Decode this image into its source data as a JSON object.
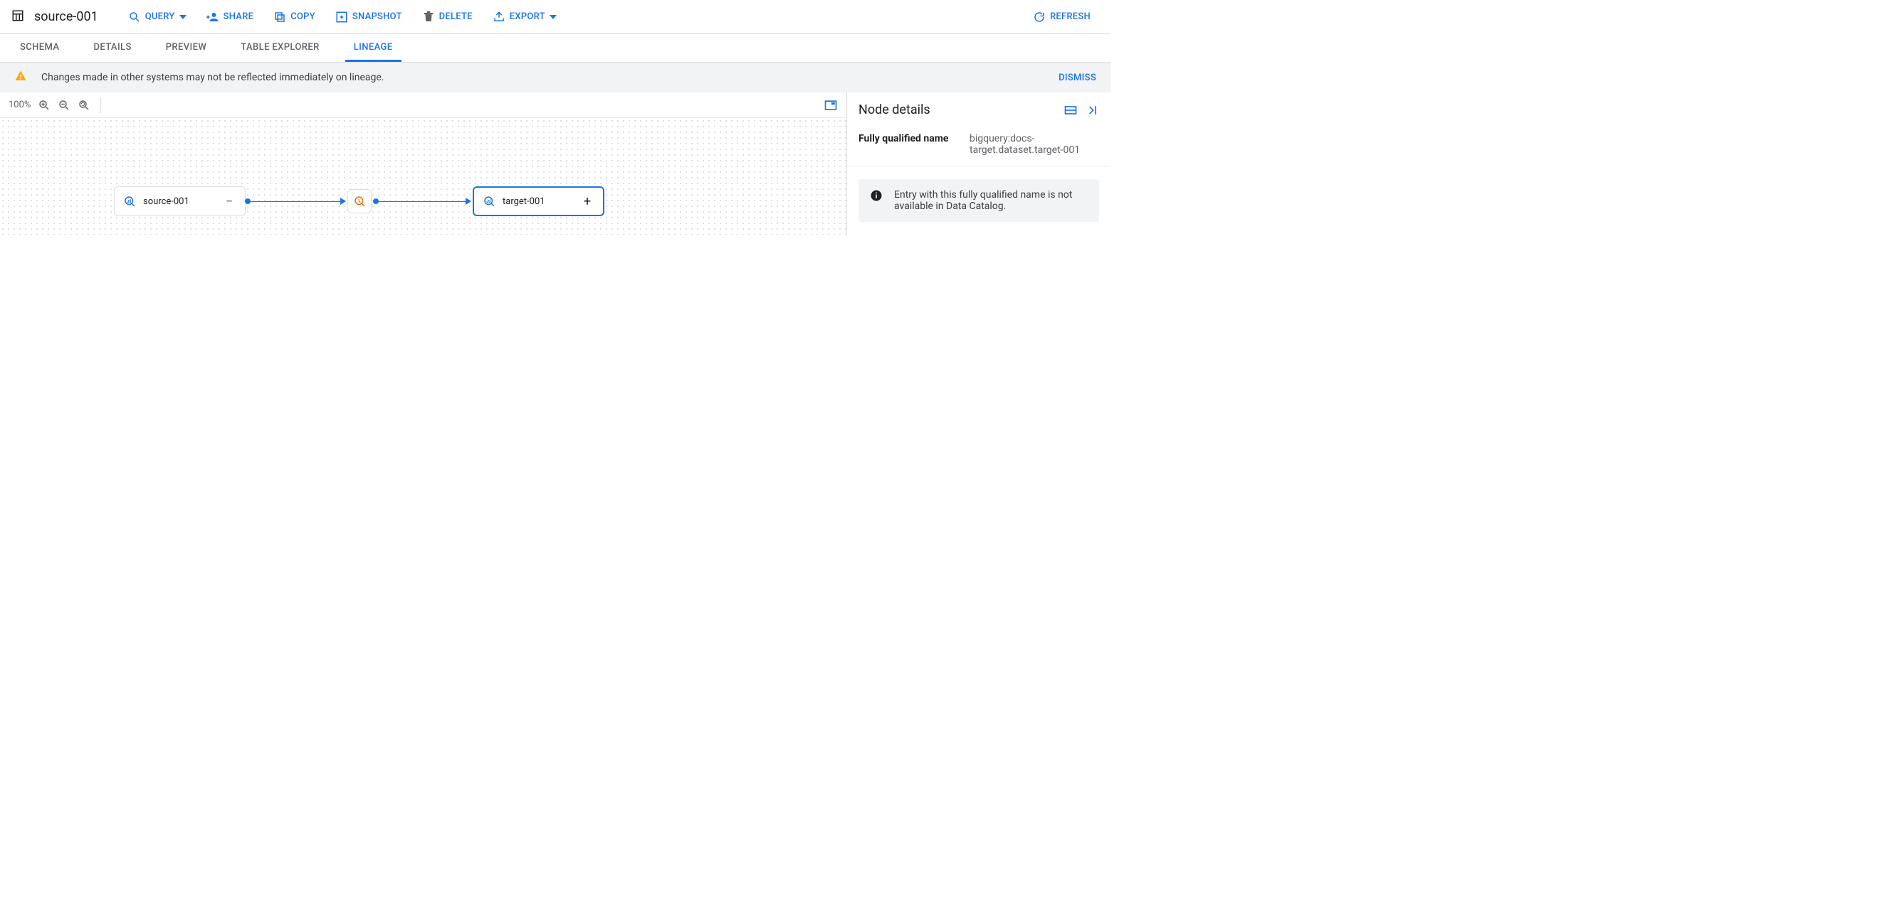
{
  "header": {
    "title": "source-001",
    "actions": {
      "query": "QUERY",
      "share": "SHARE",
      "copy": "COPY",
      "snapshot": "SNAPSHOT",
      "delete": "DELETE",
      "export": "EXPORT",
      "refresh": "REFRESH"
    }
  },
  "tabs": {
    "schema": "SCHEMA",
    "details": "DETAILS",
    "preview": "PREVIEW",
    "table_explorer": "TABLE EXPLORER",
    "lineage": "LINEAGE",
    "active": "lineage"
  },
  "banner": {
    "message": "Changes made in other systems may not be reflected immediately on lineage.",
    "dismiss": "DISMISS"
  },
  "canvas": {
    "zoom_label": "100%",
    "nodes": {
      "source": {
        "label": "source-001",
        "toggle": "−"
      },
      "process": {
        "icon": "bigquery-process"
      },
      "target": {
        "label": "target-001",
        "toggle": "+"
      }
    }
  },
  "side": {
    "title": "Node details",
    "fqn_label": "Fully qualified name",
    "fqn_value": "bigquery:docs-target.dataset.target-001",
    "note": "Entry with this fully qualified name is not available in Data Catalog."
  }
}
